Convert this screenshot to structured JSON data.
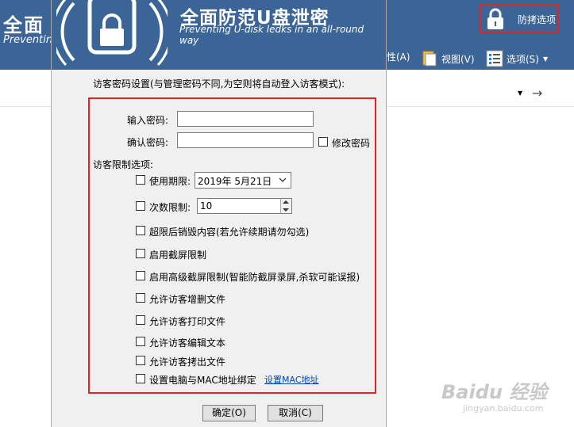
{
  "app": {
    "title": "全面",
    "subtitle": "Preventing",
    "guard_options_label": "防拷选项",
    "toolbar": {
      "properties_label": "性(A)",
      "view_label": "视图(V)",
      "options_label": "选项(S)"
    }
  },
  "dialog": {
    "banner_title": "全面防范U盘泄密",
    "banner_subtitle": "Preventing U-disk ledks in an all-round way",
    "instruction": "访客密码设置(与管理密码不同,为空则将自动登入访客模式):",
    "password": {
      "label": "输入密码:",
      "value": ""
    },
    "confirm": {
      "label": "确认密码:",
      "value": ""
    },
    "change_password_label": "修改密码",
    "options_heading": "访客限制选项:",
    "expiry": {
      "label": "使用期限:",
      "value": "2019年  5月21日"
    },
    "count_limit": {
      "label": "次数限制:",
      "value": "10"
    },
    "options": [
      {
        "label": "超限后销毁内容(若允许续期请勿勾选)"
      },
      {
        "label": "启用截屏限制"
      },
      {
        "label": "启用高级截屏限制(智能防截屏录屏,杀软可能误报)"
      },
      {
        "label": "允许访客增删文件"
      },
      {
        "label": "允许访客打印文件"
      },
      {
        "label": "允许访客编辑文本"
      },
      {
        "label": "允许访客拷出文件"
      }
    ],
    "mac_binding": {
      "label": "设置电脑与MAC地址绑定",
      "link": "设置MAC地址"
    },
    "ok_label": "确定(O)",
    "cancel_label": "取消(C)"
  },
  "watermark": {
    "brand": "Baidu 经验",
    "url": "jingyan.baidu.com"
  },
  "colors": {
    "header_blue": "#3b6497",
    "highlight_red": "#e02424",
    "link_blue": "#0645ad"
  }
}
